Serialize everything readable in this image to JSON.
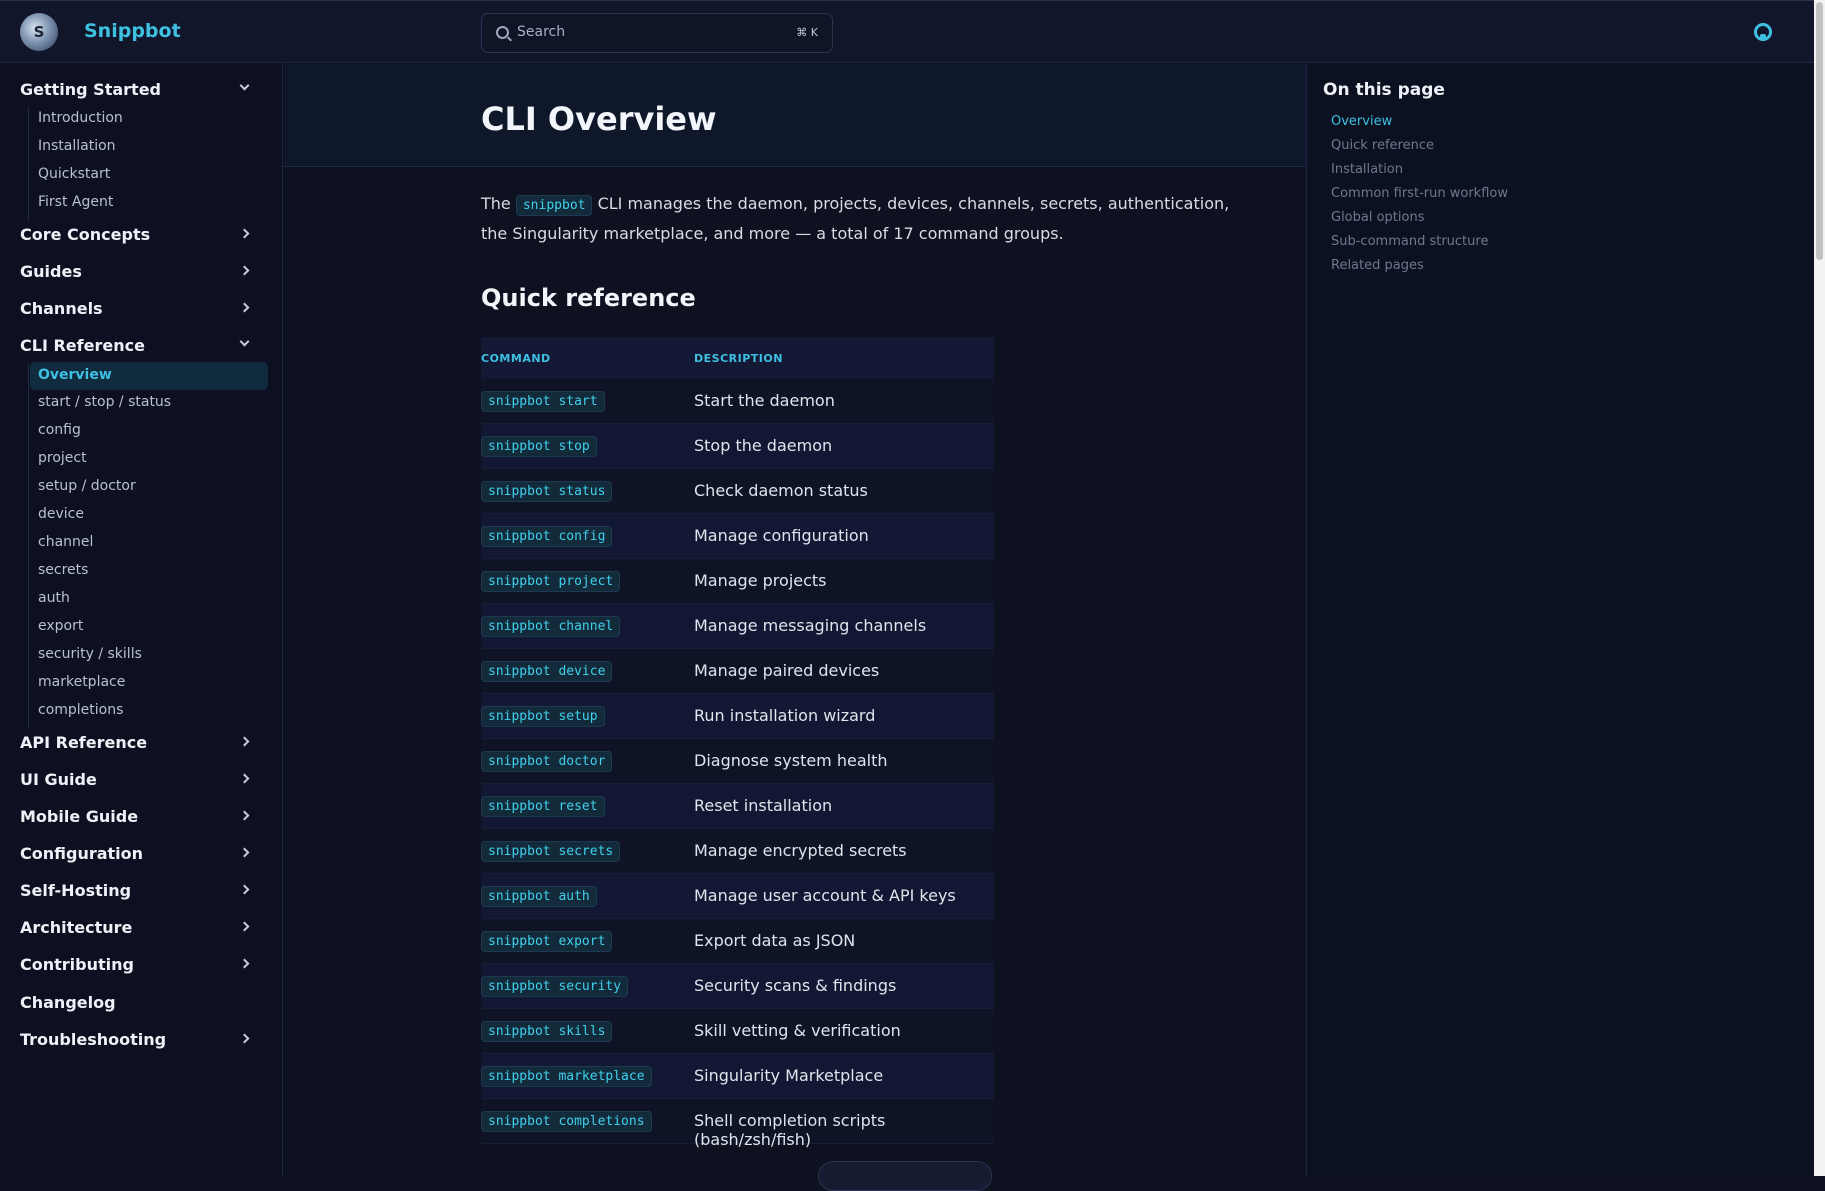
{
  "app": {
    "brand": "Snippbot",
    "logo_letter": "S"
  },
  "search": {
    "placeholder": "Search",
    "shortcut": "⌘ K"
  },
  "sidebar": {
    "sections": [
      {
        "label": "Getting Started",
        "expanded": true,
        "items": [
          "Introduction",
          "Installation",
          "Quickstart",
          "First Agent"
        ]
      },
      {
        "label": "Core Concepts",
        "expanded": false
      },
      {
        "label": "Guides",
        "expanded": false
      },
      {
        "label": "Channels",
        "expanded": false
      },
      {
        "label": "CLI Reference",
        "expanded": true,
        "items": [
          "Overview",
          "start / stop / status",
          "config",
          "project",
          "setup / doctor",
          "device",
          "channel",
          "secrets",
          "auth",
          "export",
          "security / skills",
          "marketplace",
          "completions"
        ],
        "active_item": "Overview"
      },
      {
        "label": "API Reference",
        "expanded": false
      },
      {
        "label": "UI Guide",
        "expanded": false
      },
      {
        "label": "Mobile Guide",
        "expanded": false
      },
      {
        "label": "Configuration",
        "expanded": false
      },
      {
        "label": "Self-Hosting",
        "expanded": false
      },
      {
        "label": "Architecture",
        "expanded": false
      },
      {
        "label": "Contributing",
        "expanded": false
      },
      {
        "label": "Changelog",
        "expanded": false,
        "no_chevron": true
      },
      {
        "label": "Troubleshooting",
        "expanded": false
      }
    ]
  },
  "page": {
    "title": "CLI Overview",
    "intro_prefix": "The",
    "intro_code": "snippbot",
    "intro_rest": "CLI manages the daemon, projects, devices, channels, secrets, authentication, the Singularity marketplace, and more — a total of 17 command groups.",
    "quick_ref_heading": "Quick reference",
    "table": {
      "headers": [
        "COMMAND",
        "DESCRIPTION"
      ],
      "rows": [
        {
          "cmd": "snippbot start",
          "desc": "Start the daemon"
        },
        {
          "cmd": "snippbot stop",
          "desc": "Stop the daemon"
        },
        {
          "cmd": "snippbot status",
          "desc": "Check daemon status"
        },
        {
          "cmd": "snippbot config",
          "desc": "Manage configuration"
        },
        {
          "cmd": "snippbot project",
          "desc": "Manage projects"
        },
        {
          "cmd": "snippbot channel",
          "desc": "Manage messaging channels"
        },
        {
          "cmd": "snippbot device",
          "desc": "Manage paired devices"
        },
        {
          "cmd": "snippbot setup",
          "desc": "Run installation wizard"
        },
        {
          "cmd": "snippbot doctor",
          "desc": "Diagnose system health"
        },
        {
          "cmd": "snippbot reset",
          "desc": "Reset installation"
        },
        {
          "cmd": "snippbot secrets",
          "desc": "Manage encrypted secrets"
        },
        {
          "cmd": "snippbot auth",
          "desc": "Manage user account & API keys"
        },
        {
          "cmd": "snippbot export",
          "desc": "Export data as JSON"
        },
        {
          "cmd": "snippbot security",
          "desc": "Security scans & findings"
        },
        {
          "cmd": "snippbot skills",
          "desc": "Skill vetting & verification"
        },
        {
          "cmd": "snippbot marketplace",
          "desc": "Singularity Marketplace"
        },
        {
          "cmd": "snippbot completions",
          "desc": "Shell completion scripts (bash/zsh/fish)"
        }
      ]
    }
  },
  "toc": {
    "title": "On this page",
    "items": [
      "Overview",
      "Quick reference",
      "Installation",
      "Common first-run workflow",
      "Global options",
      "Sub-command structure",
      "Related pages"
    ],
    "active": "Overview"
  },
  "colors": {
    "accent": "#3ec0e2",
    "background": "#0d1120"
  }
}
